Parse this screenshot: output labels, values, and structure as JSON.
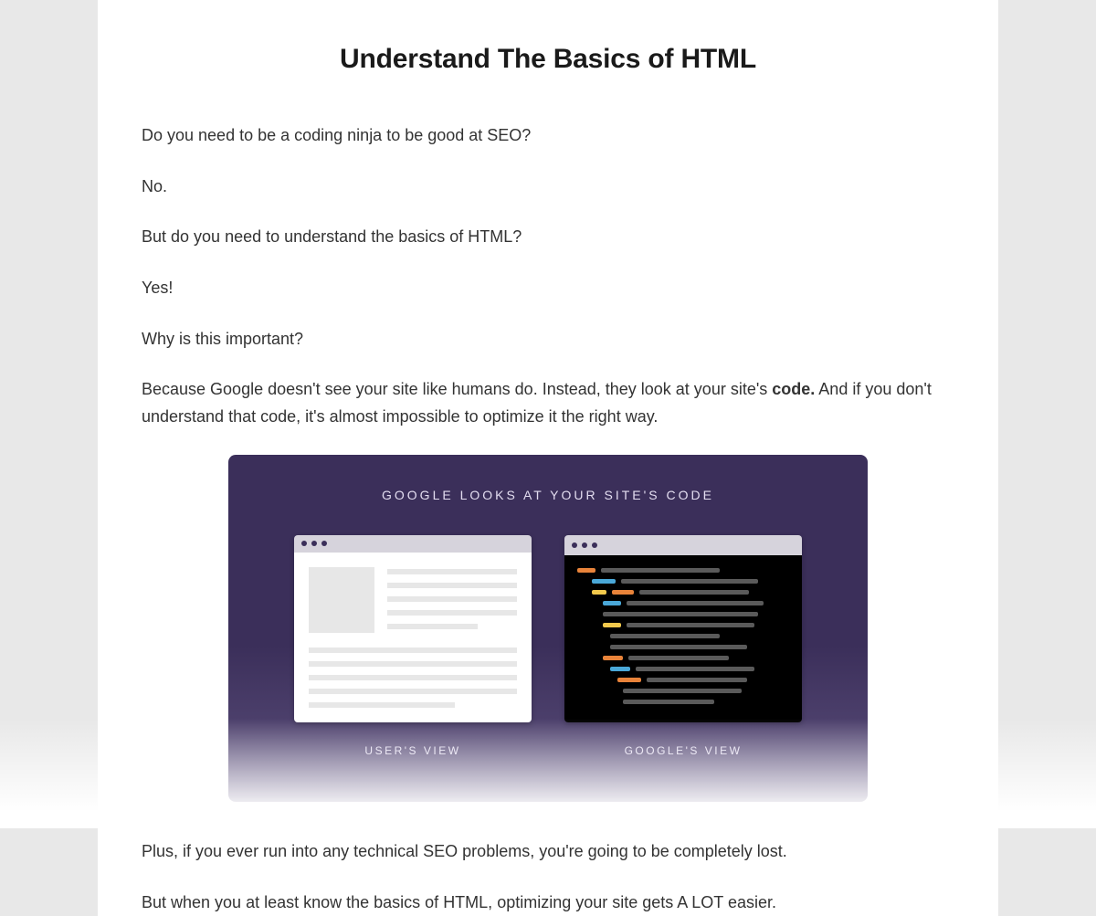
{
  "heading": "Understand The Basics of HTML",
  "paragraphs": {
    "p1": "Do you need to be a coding ninja to be good at SEO?",
    "p2": "No.",
    "p3": "But do you need to understand the basics of HTML?",
    "p4": "Yes!",
    "p5": "Why is this important?",
    "p6a": "Because Google doesn't see your site like humans do. Instead, they look at your site's ",
    "p6b": "code.",
    "p6c": " And if you don't understand that code, it's almost impossible to optimize it the right way.",
    "p7": "Plus, if you ever run into any technical SEO problems, you're going to be completely lost.",
    "p8": "But when you at least know the basics of HTML, optimizing your site gets A LOT easier."
  },
  "infographic": {
    "title": "GOOGLE LOOKS AT YOUR SITE'S CODE",
    "left_label": "USER'S VIEW",
    "right_label": "GOOGLE'S VIEW"
  }
}
